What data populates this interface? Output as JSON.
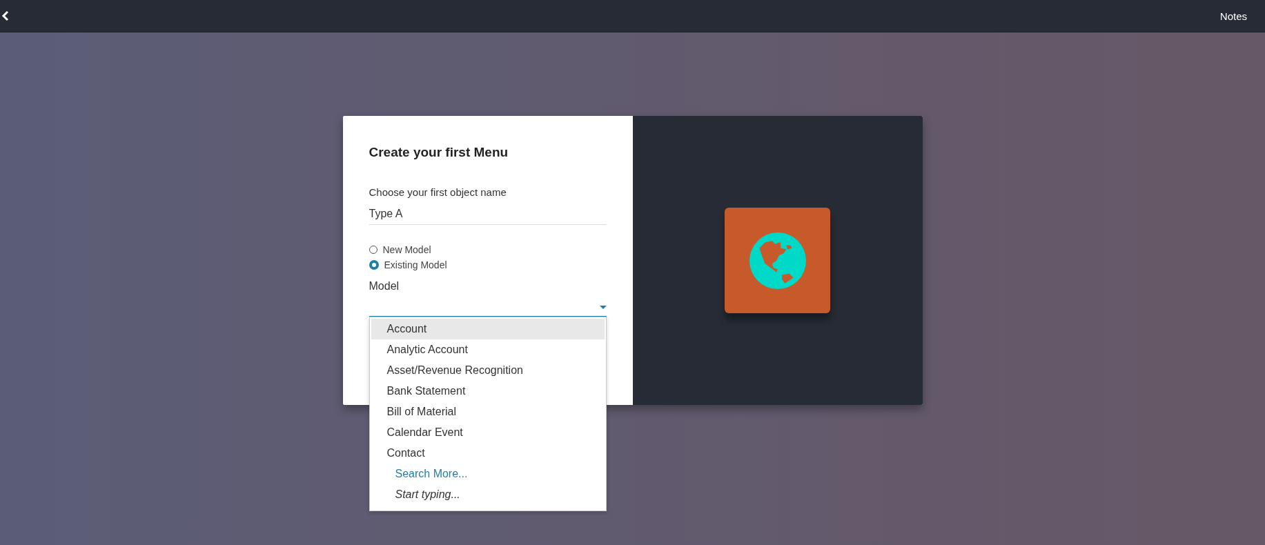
{
  "top_bar": {
    "notes_button": "Notes"
  },
  "form": {
    "title": "Create your first Menu",
    "object_name_label": "Choose your first object name",
    "object_name_value": "Type A",
    "model_options": [
      {
        "label": "New Model",
        "selected": false
      },
      {
        "label": "Existing Model",
        "selected": true
      }
    ],
    "model_label": "Model",
    "dropdown": {
      "items": [
        {
          "label": "Account",
          "selected": true
        },
        {
          "label": "Analytic Account",
          "selected": false
        },
        {
          "label": "Asset/Revenue Recognition",
          "selected": false
        },
        {
          "label": "Bank Statement",
          "selected": false
        },
        {
          "label": "Bill of Material",
          "selected": false
        },
        {
          "label": "Calendar Event",
          "selected": false
        },
        {
          "label": "Contact",
          "selected": false
        }
      ],
      "search_more": "Search More...",
      "hint": "Start typing..."
    }
  }
}
